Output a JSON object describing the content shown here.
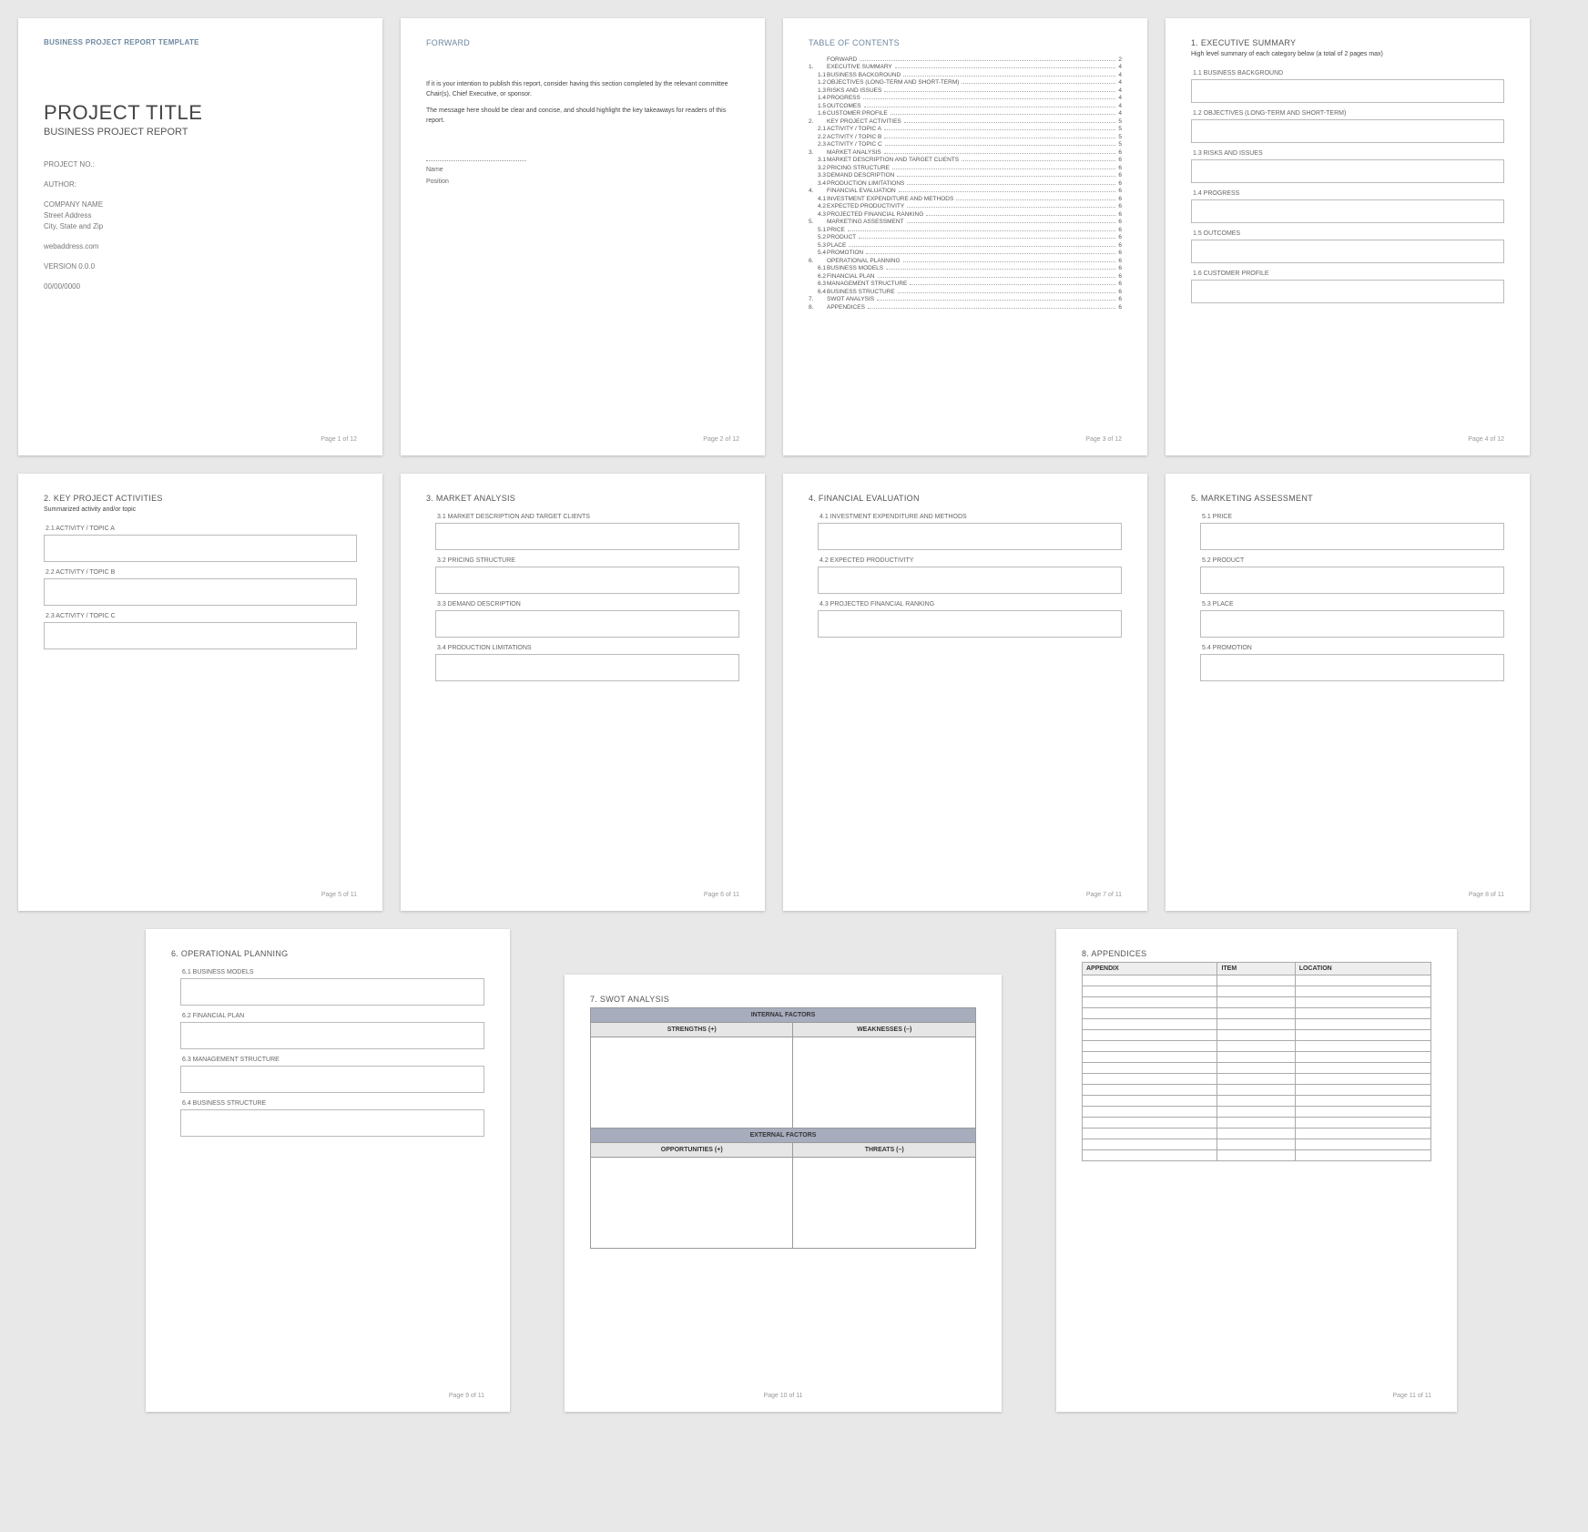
{
  "page1": {
    "header": "BUSINESS PROJECT REPORT TEMPLATE",
    "title": "PROJECT TITLE",
    "subtitle": "BUSINESS PROJECT REPORT",
    "project_no": "PROJECT NO.:",
    "author": "AUTHOR:",
    "company": "COMPANY NAME",
    "street": "Street Address",
    "city": "City, State and Zip",
    "web": "webaddress.com",
    "version": "VERSION 0.0.0",
    "date": "00/00/0000",
    "footer": "Page 1 of 12"
  },
  "page2": {
    "heading": "FORWARD",
    "p1": "If it is your intention to publish this report, consider having this section completed by the relevant committee Chair(s), Chief Executive, or sponsor.",
    "p2": "The message here should be clear and concise, and should highlight the key takeaways for readers of this report.",
    "name": "Name",
    "position": "Position",
    "footer": "Page 2 of 12"
  },
  "page3": {
    "heading": "TABLE OF CONTENTS",
    "rows": [
      {
        "n": "",
        "t": "FORWARD",
        "p": "2",
        "sub": false
      },
      {
        "n": "1.",
        "t": "EXECUTIVE SUMMARY",
        "p": "4",
        "sub": false
      },
      {
        "n": "1.1",
        "t": "BUSINESS BACKGROUND",
        "p": "4",
        "sub": true
      },
      {
        "n": "1.2",
        "t": "OBJECTIVES (LONG-TERM AND SHORT-TERM)",
        "p": "4",
        "sub": true
      },
      {
        "n": "1.3",
        "t": "RISKS AND ISSUES",
        "p": "4",
        "sub": true
      },
      {
        "n": "1.4",
        "t": "PROGRESS",
        "p": "4",
        "sub": true
      },
      {
        "n": "1.5",
        "t": "OUTCOMES",
        "p": "4",
        "sub": true
      },
      {
        "n": "1.6",
        "t": "CUSTOMER PROFILE",
        "p": "4",
        "sub": true
      },
      {
        "n": "2.",
        "t": "KEY PROJECT ACTIVITIES",
        "p": "5",
        "sub": false
      },
      {
        "n": "2.1",
        "t": "ACTIVITY / TOPIC A",
        "p": "5",
        "sub": true
      },
      {
        "n": "2.2",
        "t": "ACTIVITY / TOPIC B",
        "p": "5",
        "sub": true
      },
      {
        "n": "2.3",
        "t": "ACTIVITY / TOPIC C",
        "p": "5",
        "sub": true
      },
      {
        "n": "3.",
        "t": "MARKET ANALYSIS",
        "p": "6",
        "sub": false
      },
      {
        "n": "3.1",
        "t": "MARKET DESCRIPTION AND TARGET CLIENTS",
        "p": "6",
        "sub": true
      },
      {
        "n": "3.2",
        "t": "PRICING STRUCTURE",
        "p": "6",
        "sub": true
      },
      {
        "n": "3.3",
        "t": "DEMAND DESCRIPTION",
        "p": "6",
        "sub": true
      },
      {
        "n": "3.4",
        "t": "PRODUCTION LIMITATIONS",
        "p": "6",
        "sub": true
      },
      {
        "n": "4.",
        "t": "FINANCIAL EVALUATION",
        "p": "6",
        "sub": false
      },
      {
        "n": "4.1",
        "t": "INVESTMENT EXPENDITURE AND METHODS",
        "p": "6",
        "sub": true
      },
      {
        "n": "4.2",
        "t": "EXPECTED PRODUCTIVITY",
        "p": "6",
        "sub": true
      },
      {
        "n": "4.3",
        "t": "PROJECTED FINANCIAL RANKING",
        "p": "6",
        "sub": true
      },
      {
        "n": "5.",
        "t": "MARKETING ASSESSMENT",
        "p": "6",
        "sub": false
      },
      {
        "n": "5.1",
        "t": "PRICE",
        "p": "6",
        "sub": true
      },
      {
        "n": "5.2",
        "t": "PRODUCT",
        "p": "6",
        "sub": true
      },
      {
        "n": "5.3",
        "t": "PLACE",
        "p": "6",
        "sub": true
      },
      {
        "n": "5.4",
        "t": "PROMOTION",
        "p": "6",
        "sub": true
      },
      {
        "n": "6.",
        "t": "OPERATIONAL PLANNING",
        "p": "6",
        "sub": false
      },
      {
        "n": "6.1",
        "t": "BUSINESS MODELS",
        "p": "6",
        "sub": true
      },
      {
        "n": "6.2",
        "t": "FINANCIAL PLAN",
        "p": "6",
        "sub": true
      },
      {
        "n": "6.3",
        "t": "MANAGEMENT STRUCTURE",
        "p": "6",
        "sub": true
      },
      {
        "n": "6.4",
        "t": "BUSINESS STRUCTURE",
        "p": "6",
        "sub": true
      },
      {
        "n": "7.",
        "t": "SWOT ANALYSIS",
        "p": "6",
        "sub": false
      },
      {
        "n": "8.",
        "t": "APPENDICES",
        "p": "6",
        "sub": false
      }
    ],
    "footer": "Page 3 of 12"
  },
  "page4": {
    "heading": "1. EXECUTIVE SUMMARY",
    "desc": "High level summary of each category below (a total of 2 pages max)",
    "subs": [
      "1.1  BUSINESS BACKGROUND",
      "1.2  OBJECTIVES (LONG-TERM AND SHORT-TERM)",
      "1.3  RISKS AND ISSUES",
      "1.4  PROGRESS",
      "1.5  OUTCOMES",
      "1.6  CUSTOMER PROFILE"
    ],
    "footer": "Page 4 of 12"
  },
  "page5": {
    "heading": "2. KEY PROJECT ACTIVITIES",
    "desc": "Summarized activity and/or topic",
    "subs": [
      "2.1  ACTIVITY / TOPIC A",
      "2.2  ACTIVITY / TOPIC B",
      "2.3  ACTIVITY / TOPIC C"
    ],
    "footer": "Page 5 of 11"
  },
  "page6": {
    "heading": "3. MARKET ANALYSIS",
    "subs": [
      "3.1  MARKET DESCRIPTION AND TARGET CLIENTS",
      "3.2  PRICING STRUCTURE",
      "3.3  DEMAND DESCRIPTION",
      "3.4  PRODUCTION LIMITATIONS"
    ],
    "footer": "Page 6 of 11"
  },
  "page7": {
    "heading": "4. FINANCIAL EVALUATION",
    "subs": [
      "4.1  INVESTMENT EXPENDITURE AND METHODS",
      "4.2  EXPECTED PRODUCTIVITY",
      "4.3  PROJECTED FINANCIAL RANKING"
    ],
    "footer": "Page 7 of 11"
  },
  "page8": {
    "heading": "5. MARKETING ASSESSMENT",
    "subs": [
      "5.1  PRICE",
      "5.2  PRODUCT",
      "5.3  PLACE",
      "5.4  PROMOTION"
    ],
    "footer": "Page 8 of 11"
  },
  "page9": {
    "heading": "6. OPERATIONAL PLANNING",
    "subs": [
      "6.1  BUSINESS MODELS",
      "6.2  FINANCIAL PLAN",
      "6.3  MANAGEMENT STRUCTURE",
      "6.4  BUSINESS STRUCTURE"
    ],
    "footer": "Page 9 of 11"
  },
  "page10": {
    "heading": "7. SWOT ANALYSIS",
    "internal": "INTERNAL FACTORS",
    "strengths": "STRENGTHS (+)",
    "weaknesses": "WEAKNESSES (–)",
    "external": "EXTERNAL FACTORS",
    "opportunities": "OPPORTUNITIES (+)",
    "threats": "THREATS (–)",
    "footer": "Page 10 of 11"
  },
  "page11": {
    "heading": "8. APPENDICES",
    "cols": [
      "APPENDIX",
      "ITEM",
      "LOCATION"
    ],
    "rows": 17,
    "footer": "Page 11 of 11"
  }
}
